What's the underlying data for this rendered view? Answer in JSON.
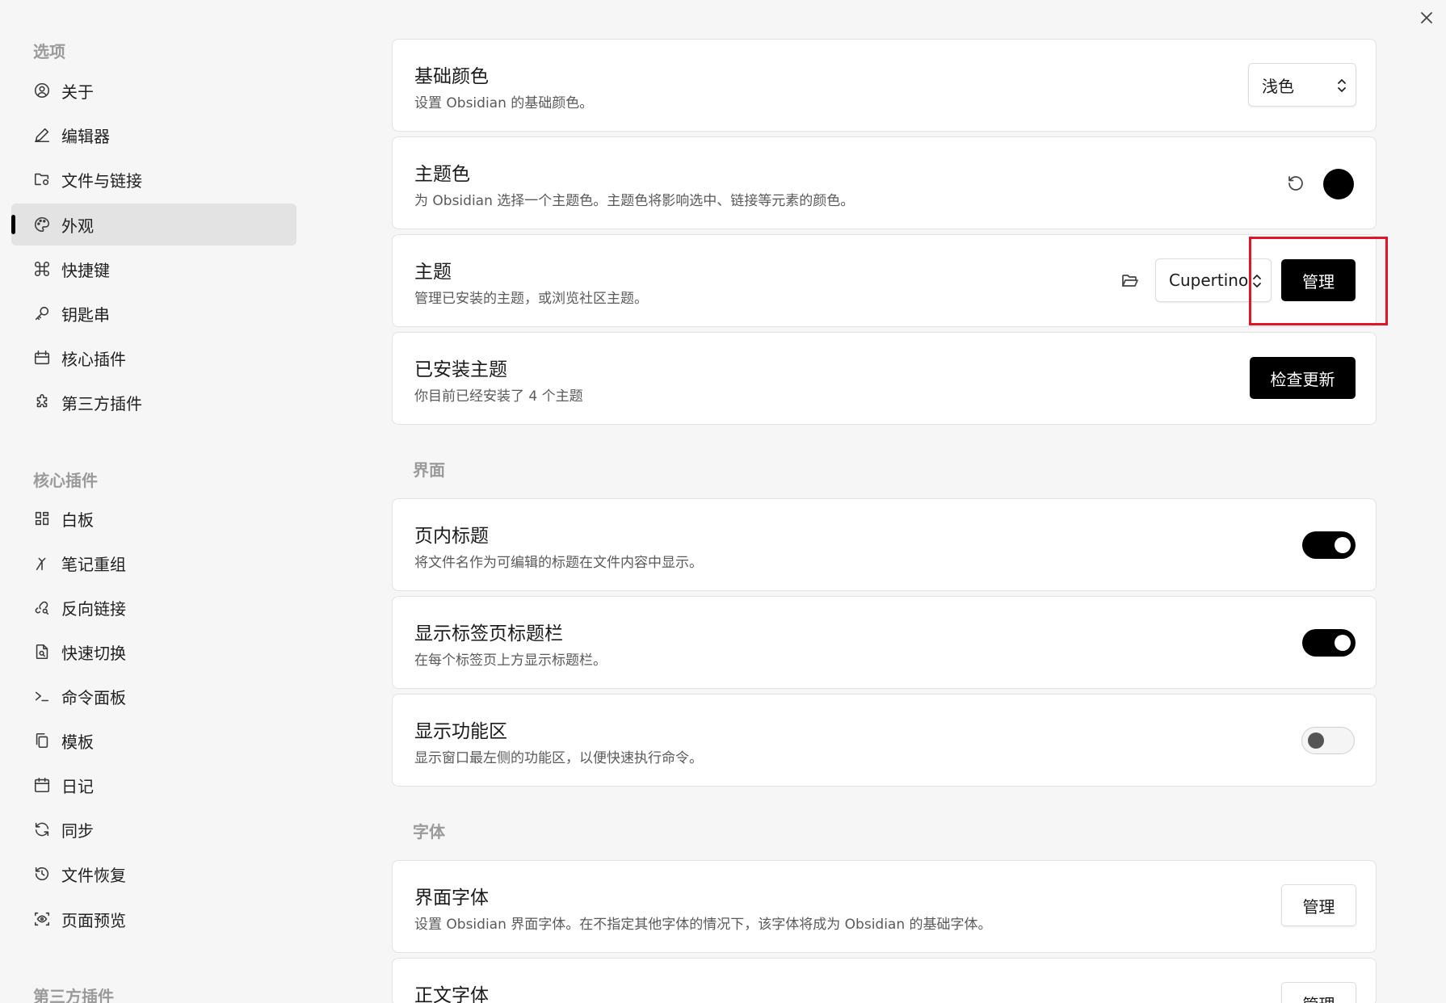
{
  "sidebar": {
    "options_title": "选项",
    "options_items": [
      {
        "label": "关于",
        "icon": "user-circle-icon"
      },
      {
        "label": "编辑器",
        "icon": "pencil-icon"
      },
      {
        "label": "文件与链接",
        "icon": "folder-cog-icon"
      },
      {
        "label": "外观",
        "icon": "palette-icon",
        "active": true
      },
      {
        "label": "快捷键",
        "icon": "command-icon"
      },
      {
        "label": "钥匙串",
        "icon": "key-icon"
      },
      {
        "label": "核心插件",
        "icon": "calendar-box-icon"
      },
      {
        "label": "第三方插件",
        "icon": "puzzle-icon"
      }
    ],
    "core_title": "核心插件",
    "core_items": [
      {
        "label": "白板",
        "icon": "layout-dashboard-icon"
      },
      {
        "label": "笔记重组",
        "icon": "merge-icon"
      },
      {
        "label": "反向链接",
        "icon": "link-search-icon"
      },
      {
        "label": "快速切换",
        "icon": "file-search-icon"
      },
      {
        "label": "命令面板",
        "icon": "terminal-icon"
      },
      {
        "label": "模板",
        "icon": "copy-icon"
      },
      {
        "label": "日记",
        "icon": "calendar-icon"
      },
      {
        "label": "同步",
        "icon": "refresh-icon"
      },
      {
        "label": "文件恢复",
        "icon": "history-icon"
      },
      {
        "label": "页面预览",
        "icon": "scan-eye-icon"
      }
    ],
    "third_title": "第三方插件"
  },
  "settings": {
    "base_color": {
      "title": "基础颜色",
      "desc": "设置 Obsidian 的基础颜色。",
      "value": "浅色"
    },
    "accent_color": {
      "title": "主题色",
      "desc": "为 Obsidian 选择一个主题色。主题色将影响选中、链接等元素的颜色。",
      "swatch": "#000000"
    },
    "theme": {
      "title": "主题",
      "desc": "管理已安装的主题，或浏览社区主题。",
      "value": "Cupertino",
      "button": "管理"
    },
    "installed": {
      "title": "已安装主题",
      "desc": "你目前已经安装了 4 个主题",
      "button": "检查更新"
    },
    "interface_head": "界面",
    "inline_title": {
      "title": "页内标题",
      "desc": "将文件名作为可编辑的标题在文件内容中显示。",
      "enabled": true
    },
    "tab_title_bar": {
      "title": "显示标签页标题栏",
      "desc": "在每个标签页上方显示标题栏。",
      "enabled": true
    },
    "ribbon": {
      "title": "显示功能区",
      "desc": "显示窗口最左侧的功能区，以便快速执行命令。",
      "enabled": false
    },
    "font_head": "字体",
    "interface_font": {
      "title": "界面字体",
      "desc": "设置 Obsidian 界面字体。在不指定其他字体的情况下，该字体将成为 Obsidian 的基础字体。",
      "button": "管理"
    },
    "text_font": {
      "title": "正文字体",
      "button": "管理"
    }
  },
  "colors": {
    "accent": "#000000",
    "highlight": "#e0152a"
  }
}
